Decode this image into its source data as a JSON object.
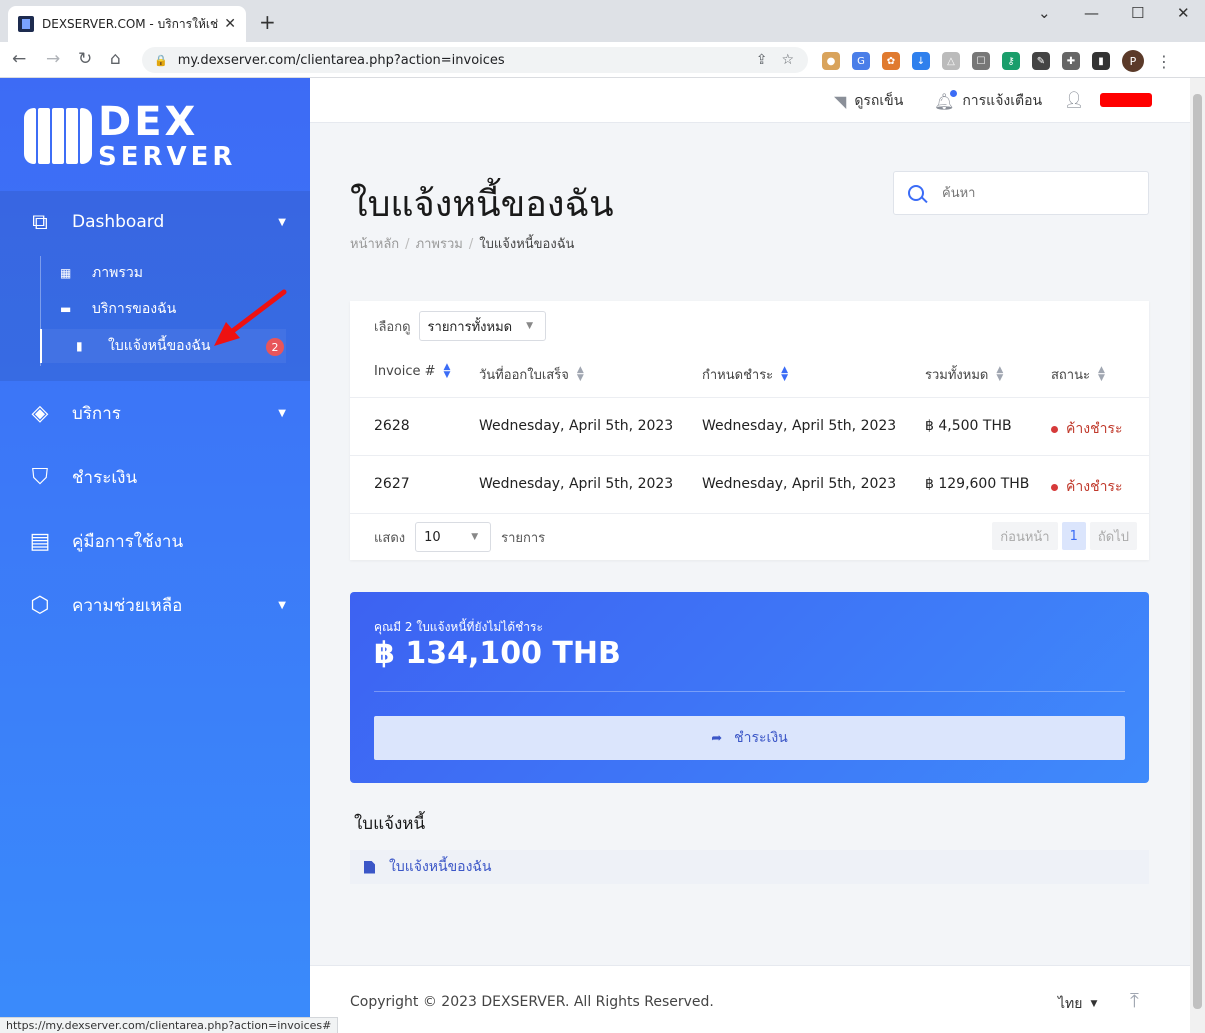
{
  "browser": {
    "tab_title": "DEXSERVER.COM - บริการให้เช่าและ",
    "url": "my.dexserver.com/clientarea.php?action=invoices",
    "profile_initial": "P",
    "status_url": "https://my.dexserver.com/clientarea.php?action=invoices#"
  },
  "logo": {
    "line1": "DEX",
    "line2": "SERVER"
  },
  "sidebar": {
    "dashboard": "Dashboard",
    "sub": {
      "overview": "ภาพรวม",
      "services": "บริการของฉัน",
      "invoices": "ใบแจ้งหนี้ของฉัน",
      "invoices_badge": "2"
    },
    "services": "บริการ",
    "billing": "ชำระเงิน",
    "manual": "คู่มือการใช้งาน",
    "support": "ความช่วยเหลือ"
  },
  "topbar": {
    "cart": "ดูรถเข็น",
    "notifications": "การแจ้งเตือน"
  },
  "page": {
    "title": "ใบแจ้งหนี้ของฉัน",
    "breadcrumb": [
      "หน้าหลัก",
      "ภาพรวม",
      "ใบแจ้งหนี้ของฉัน"
    ],
    "search_placeholder": "ค้นหา"
  },
  "table": {
    "filter_label": "เลือกดู",
    "filter_value": "รายการทั้งหมด",
    "headers": [
      "Invoice #",
      "วันที่ออกใบเสร็จ",
      "กำหนดชำระ",
      "รวมทั้งหมด",
      "สถานะ"
    ],
    "rows": [
      {
        "id": "2628",
        "issued": "Wednesday, April 5th, 2023",
        "due": "Wednesday, April 5th, 2023",
        "total": "฿ 4,500 THB",
        "status": "ค้างชำระ"
      },
      {
        "id": "2627",
        "issued": "Wednesday, April 5th, 2023",
        "due": "Wednesday, April 5th, 2023",
        "total": "฿ 129,600 THB",
        "status": "ค้างชำระ"
      }
    ],
    "show_label": "แสดง",
    "show_value": "10",
    "show_suffix": "รายการ",
    "prev": "ก่อนหน้า",
    "page": "1",
    "next": "ถัดไป"
  },
  "due_panel": {
    "label": "คุณมี 2 ใบแจ้งหนี้ที่ยังไม่ได้ชำระ",
    "amount": "฿ 134,100 THB",
    "pay_button": "ชำระเงิน"
  },
  "invoice_section": {
    "title": "ใบแจ้งหนี้",
    "link": "ใบแจ้งหนี้ของฉัน"
  },
  "footer": {
    "copyright": "Copyright © 2023 DEXSERVER. All Rights Reserved.",
    "language": "ไทย"
  },
  "colors": {
    "accent": "#3b6cf6",
    "overdue": "#c0392b",
    "badge": "#e8555a"
  }
}
